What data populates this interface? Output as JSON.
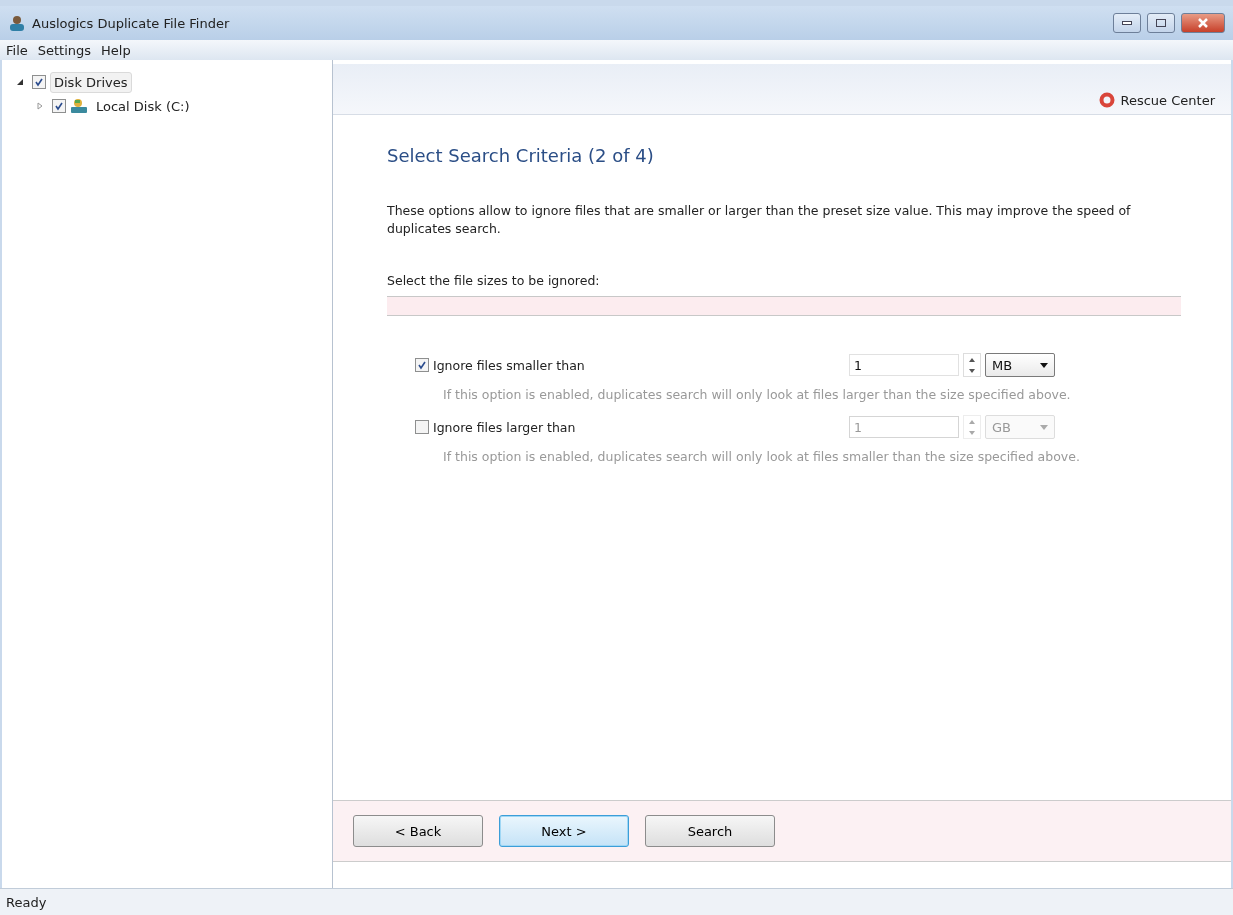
{
  "window": {
    "title": "Auslogics Duplicate File Finder"
  },
  "menu": [
    "File",
    "Settings",
    "Help"
  ],
  "tree": [
    {
      "label": "Disk Drives",
      "checked": true,
      "expanded": true,
      "selected": true,
      "children": [
        {
          "label": "Local Disk (C:)",
          "checked": true,
          "expanded": false,
          "selected": false
        }
      ]
    }
  ],
  "header": {
    "link": "Rescue Center"
  },
  "page": {
    "title": "Select Search Criteria (2 of 4)",
    "intro": "These options allow to ignore files that are smaller or larger than the preset size value. This may improve the speed of duplicates search.",
    "section": "Select the file sizes to be ignored:"
  },
  "options": [
    {
      "label": "Ignore files smaller than",
      "checked": true,
      "value": "1",
      "unit": "MB",
      "hint": "If this option is enabled, duplicates search will only look at files larger than the size specified above."
    },
    {
      "label": "Ignore files larger than",
      "checked": false,
      "value": "1",
      "unit": "GB",
      "hint": "If this option is enabled, duplicates search will only look at files smaller than the size specified above."
    }
  ],
  "buttons": [
    {
      "label": "< Back",
      "default": false
    },
    {
      "label": "Next >",
      "default": true
    },
    {
      "label": "Search",
      "default": false
    }
  ],
  "status_bar": "Ready"
}
